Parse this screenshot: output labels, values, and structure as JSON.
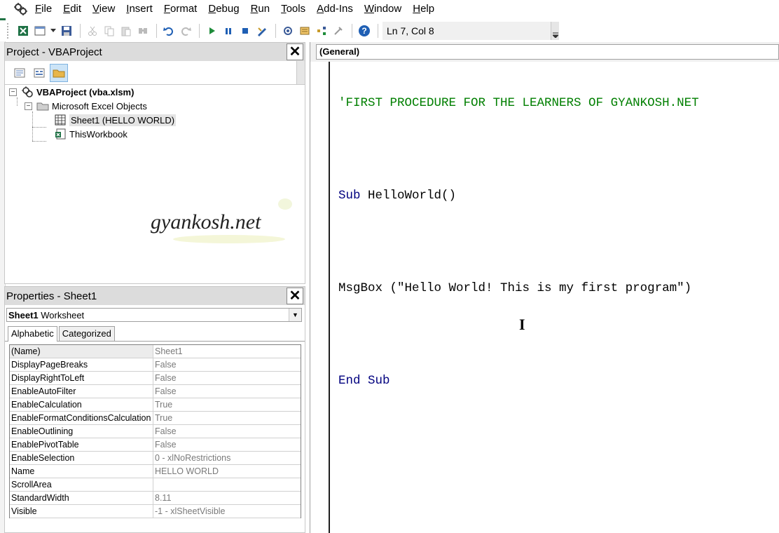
{
  "menu": {
    "items": [
      "File",
      "Edit",
      "View",
      "Insert",
      "Format",
      "Debug",
      "Run",
      "Tools",
      "Add-Ins",
      "Window",
      "Help"
    ]
  },
  "toolbar": {
    "position_text": "Ln 7, Col 8",
    "icons": [
      "view-excel-icon",
      "insert-userform-icon",
      "save-icon",
      "cut-icon",
      "copy-icon",
      "paste-icon",
      "find-icon",
      "undo-icon",
      "redo-icon",
      "run-icon",
      "break-icon",
      "reset-icon",
      "design-mode-icon",
      "project-explorer-icon",
      "properties-window-icon",
      "object-browser-icon",
      "toolbox-icon",
      "help-icon"
    ]
  },
  "project": {
    "title": "Project - VBAProject",
    "root_label": "VBAProject (vba.xlsm)",
    "folder_label": "Microsoft Excel Objects",
    "items": [
      "Sheet1 (HELLO WORLD)",
      "ThisWorkbook"
    ],
    "watermark": "gyankosh.net"
  },
  "properties": {
    "title": "Properties - Sheet1",
    "object_name": "Sheet1",
    "object_type": "Worksheet",
    "tabs": [
      "Alphabetic",
      "Categorized"
    ],
    "rows": [
      {
        "name": "(Name)",
        "value": "Sheet1"
      },
      {
        "name": "DisplayPageBreaks",
        "value": "False"
      },
      {
        "name": "DisplayRightToLeft",
        "value": "False"
      },
      {
        "name": "EnableAutoFilter",
        "value": "False"
      },
      {
        "name": "EnableCalculation",
        "value": "True"
      },
      {
        "name": "EnableFormatConditionsCalculation",
        "value": "True"
      },
      {
        "name": "EnableOutlining",
        "value": "False"
      },
      {
        "name": "EnablePivotTable",
        "value": "False"
      },
      {
        "name": "EnableSelection",
        "value": "0 - xlNoRestrictions"
      },
      {
        "name": "Name",
        "value": "HELLO WORLD"
      },
      {
        "name": "ScrollArea",
        "value": ""
      },
      {
        "name": "StandardWidth",
        "value": "8.11"
      },
      {
        "name": "Visible",
        "value": "-1 - xlSheetVisible"
      }
    ]
  },
  "code": {
    "object_combo": "(General)",
    "comment_line": "'FIRST PROCEDURE FOR THE LEARNERS OF GYANKOSH.NET",
    "sub_keyword": "Sub",
    "sub_name": " HelloWorld()",
    "msgbox_line": "MsgBox (\"Hello World! This is my first program\")",
    "end_sub": "End Sub"
  }
}
